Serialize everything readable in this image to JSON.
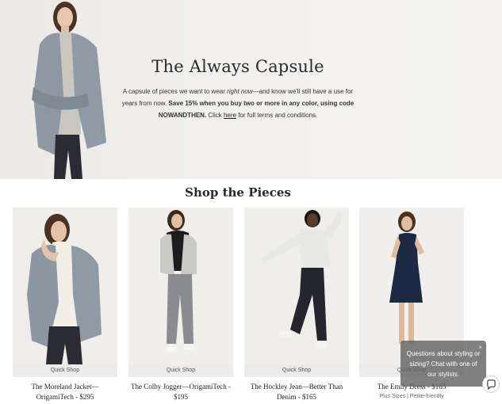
{
  "hero": {
    "title": "The Always Capsule",
    "desc_part1": "A capsule of pieces we want to wear ",
    "desc_italic": "right now",
    "desc_part2": "—and know we'll still have a use for years from now. ",
    "desc_bold": "Save 15% when you buy two or more in any color, using code NOWANDTHEN.",
    "desc_part3": " Click ",
    "link_text": "here",
    "desc_part4": " for full terms and conditions."
  },
  "section": {
    "title": "Shop the Pieces"
  },
  "products": [
    {
      "name": "The Moreland Jacket—OrigamiTech - $295",
      "quick_shop": "Quick Shop"
    },
    {
      "name": "The Colby Jogger—OrigamiTech - $195",
      "quick_shop": "Quick Shop"
    },
    {
      "name": "The Hockley Jean—Better Than Denim - $165",
      "quick_shop": "Quick Shop"
    },
    {
      "name": "The Emily Dress - $165",
      "quick_shop": "Quick Shop",
      "sub": "Plus Sizes | Petite-friendly"
    }
  ],
  "chat": {
    "message": "Questions about styling or sizing? Chat with one of our stylists.",
    "close": "×",
    "button_icon": "chat-bubble-icon"
  },
  "colors": {
    "hero_bg": "#f1f0ee",
    "jacket": "#8d98a3",
    "pants": "#2b2c33",
    "dress": "#1e2a44",
    "chat_bg": "#646464"
  }
}
